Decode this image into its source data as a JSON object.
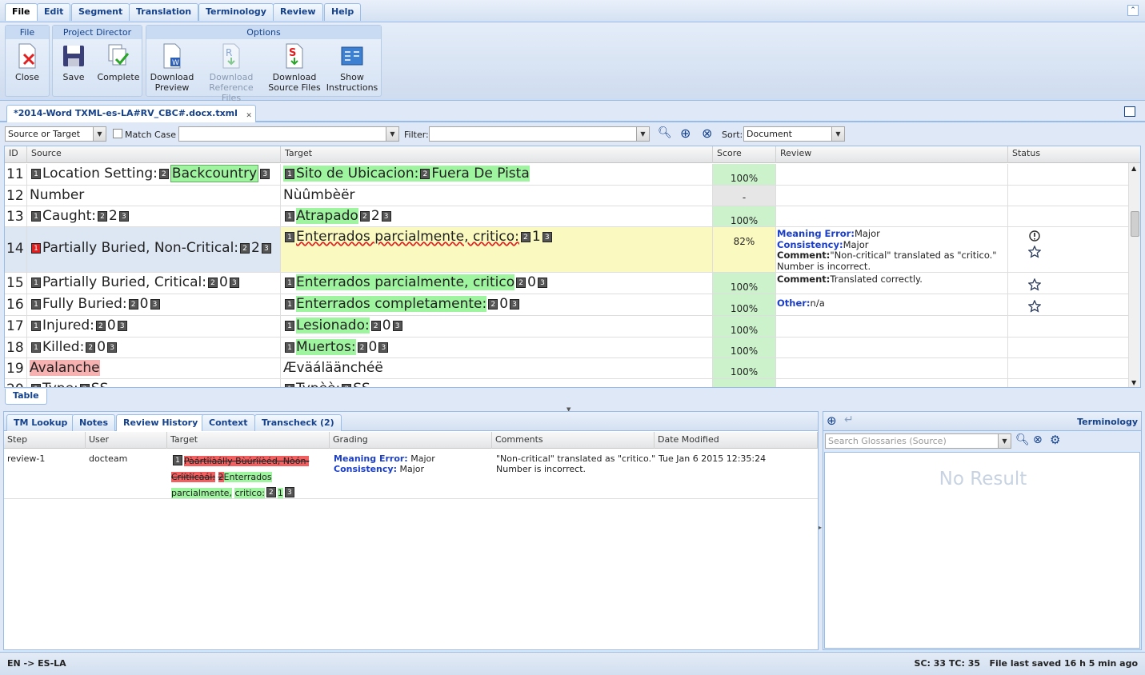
{
  "menu": {
    "items": [
      "File",
      "Edit",
      "Segment",
      "Translation",
      "Terminology",
      "Review",
      "Help"
    ],
    "active": "File"
  },
  "ribbon": {
    "groups": {
      "file": "File",
      "project_director": "Project Director",
      "options": "Options"
    },
    "buttons": {
      "close": "Close",
      "save": "Save",
      "complete": "Complete",
      "download_preview": [
        "Download",
        "Preview"
      ],
      "download_reference": [
        "Download",
        "Reference Files"
      ],
      "download_source": [
        "Download",
        "Source Files"
      ],
      "show_instructions": [
        "Show",
        "Instructions"
      ]
    }
  },
  "document_tab": "*2014-Word TXML-es-LA#RV_CBC#.docx.txml",
  "filter": {
    "scope": "Source or Target",
    "match_case": "Match Case",
    "search_value": "",
    "filter_label": "Filter:",
    "filter_value": "",
    "sort_label": "Sort:",
    "sort_value": "Document"
  },
  "grid": {
    "columns": {
      "id": "ID",
      "source": "Source",
      "target": "Target",
      "score": "Score",
      "review": "Review",
      "status": "Status"
    },
    "rows": [
      {
        "id": "11",
        "source_pre": "Location Setting:",
        "source_hl": "Backcountry",
        "target_a": "Sito de Ubicacion:",
        "target_b": "Fuera De Pista",
        "score": "100%"
      },
      {
        "id": "12",
        "source": "Number",
        "target": "Nùûmbèër",
        "score": "-"
      },
      {
        "id": "13",
        "source": "Caught:",
        "source_num": "2",
        "target": "Atrapado",
        "target_num": "2",
        "score": "100%"
      },
      {
        "id": "14",
        "source": "Partially Buried, Non-Critical:",
        "source_num": "2",
        "target": "Enterrados parcialmente, critico:",
        "target_num": "1",
        "score": "82%",
        "review": {
          "k1": "Meaning Error:",
          "v1": "Major",
          "k2": "Consistency:",
          "v2": "Major",
          "k3": "Comment:",
          "v3": "\"Non-critical\" translated as \"critico.\" Number is incorrect."
        }
      },
      {
        "id": "15",
        "source": "Partially Buried, Critical:",
        "source_num": "0",
        "target": "Enterrados parcialmente, critico",
        "target_num": "0",
        "score": "100%",
        "review": {
          "k1": "Comment:",
          "v1": "Translated correctly."
        }
      },
      {
        "id": "16",
        "source": "Fully Buried:",
        "source_num": "0",
        "target": "Enterrados completamente:",
        "target_num": "0",
        "score": "100%",
        "review": {
          "k1": "Other:",
          "v1": "n/a"
        }
      },
      {
        "id": "17",
        "source": "Injured:",
        "source_num": "0",
        "target": "Lesionado:",
        "target_num": "0",
        "score": "100%"
      },
      {
        "id": "18",
        "source": "Killed:",
        "source_num": "0",
        "target": "Muertos:",
        "target_num": "0",
        "score": "100%"
      },
      {
        "id": "19",
        "source": "Avalanche",
        "target": "Æväáläänchéë",
        "score": "100%"
      },
      {
        "id": "20",
        "source": "Type:",
        "source_num": "SS",
        "target": "Typèè:",
        "target_num": "SS",
        "score": ""
      }
    ]
  },
  "table_tab": "Table",
  "bottom_tabs": [
    "TM Lookup",
    "Notes",
    "Review History",
    "Context",
    "Transcheck (2)"
  ],
  "history": {
    "columns": {
      "step": "Step",
      "user": "User",
      "target": "Target",
      "grading": "Grading",
      "comments": "Comments",
      "date": "Date Modified"
    },
    "row": {
      "step": "review-1",
      "user": "docteam",
      "target_deleted_a": "Pàártîíàálly Bùúrîíèéd, Nòón-",
      "target_deleted_b": "Crîítîícàál:",
      "target_deleted_num": "2",
      "target_inserted_a": "Enterrados parcialmente,",
      "target_inserted_b": "critico:",
      "target_num": "1",
      "grading_k1": "Meaning Error:",
      "grading_v1": "Major",
      "grading_k2": "Consistency:",
      "grading_v2": "Major",
      "comment_a": "\"Non-critical\" translated as \"critico.\"",
      "comment_b": "Number is incorrect.",
      "date": "Tue Jan 6 2015 12:35:24"
    }
  },
  "terminology": {
    "title": "Terminology",
    "search_placeholder": "Search Glossaries (Source)",
    "no_result": "No Result"
  },
  "statusbar": {
    "lang": "EN -> ES-LA",
    "right": "SC: 33 TC: 35   File last saved 16 h 5 min ago"
  }
}
